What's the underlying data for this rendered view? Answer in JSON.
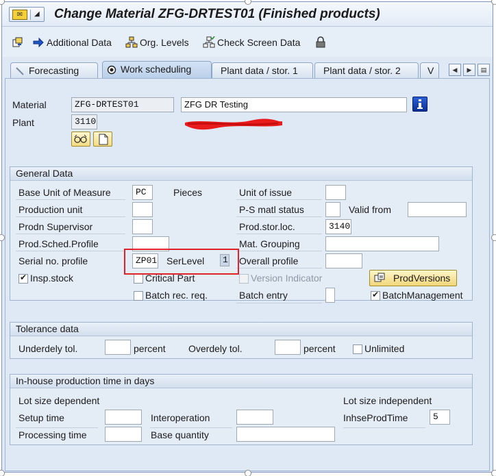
{
  "title": "Change Material ZFG-DRTEST01 (Finished products)",
  "toolbar": {
    "additional_data": "Additional Data",
    "org_levels": "Org. Levels",
    "check_screen_data": "Check Screen Data"
  },
  "tabs": [
    {
      "label": "Forecasting"
    },
    {
      "label": "Work scheduling"
    },
    {
      "label": "Plant data / stor. 1"
    },
    {
      "label": "Plant data / stor. 2"
    },
    {
      "label": "V"
    }
  ],
  "header": {
    "material_label": "Material",
    "material_value": "ZFG-DRTEST01",
    "material_desc": "ZFG DR Testing",
    "plant_label": "Plant",
    "plant_value": "3110"
  },
  "general": {
    "title": "General Data",
    "base_uom_label": "Base Unit of Measure",
    "base_uom_value": "PC",
    "base_uom_text": "Pieces",
    "unit_of_issue_label": "Unit of issue",
    "production_unit_label": "Production unit",
    "ps_matl_status_label": "P-S matl status",
    "valid_from_label": "Valid from",
    "prodn_supervisor_label": "Prodn Supervisor",
    "prod_stor_loc_label": "Prod.stor.loc.",
    "prod_stor_loc_value": "3140",
    "prod_sched_profile_label": "Prod.Sched.Profile",
    "mat_grouping_label": "Mat. Grouping",
    "serial_no_profile_label": "Serial no. profile",
    "serial_no_profile_value": "ZP01",
    "serlevel_label": "SerLevel",
    "serlevel_value": "1",
    "overall_profile_label": "Overall profile",
    "insp_stock_label": "Insp.stock",
    "critical_part_label": "Critical Part",
    "version_indicator_label": "Version Indicator",
    "prod_versions_button": "ProdVersions",
    "batch_rec_req_label": "Batch rec. req.",
    "batch_entry_label": "Batch entry",
    "batch_management_label": "BatchManagement"
  },
  "tolerance": {
    "title": "Tolerance data",
    "underdely_label": "Underdely tol.",
    "percent_1": "percent",
    "overdely_label": "Overdely tol.",
    "percent_2": "percent",
    "unlimited_label": "Unlimited"
  },
  "inhouse": {
    "title": "In-house production time in days",
    "lot_size_dependent": "Lot size dependent",
    "lot_size_independent": "Lot size independent",
    "setup_time_label": "Setup time",
    "interoperation_label": "Interoperation",
    "inhse_prod_time_label": "InhseProdTime",
    "inhse_prod_time_value": "5",
    "processing_time_label": "Processing time",
    "base_quantity_label": "Base quantity"
  },
  "colors": {
    "accent_blue": "#0a3fa8",
    "highlight_red": "#e0202a",
    "button_yellow": "#f1d77a"
  }
}
